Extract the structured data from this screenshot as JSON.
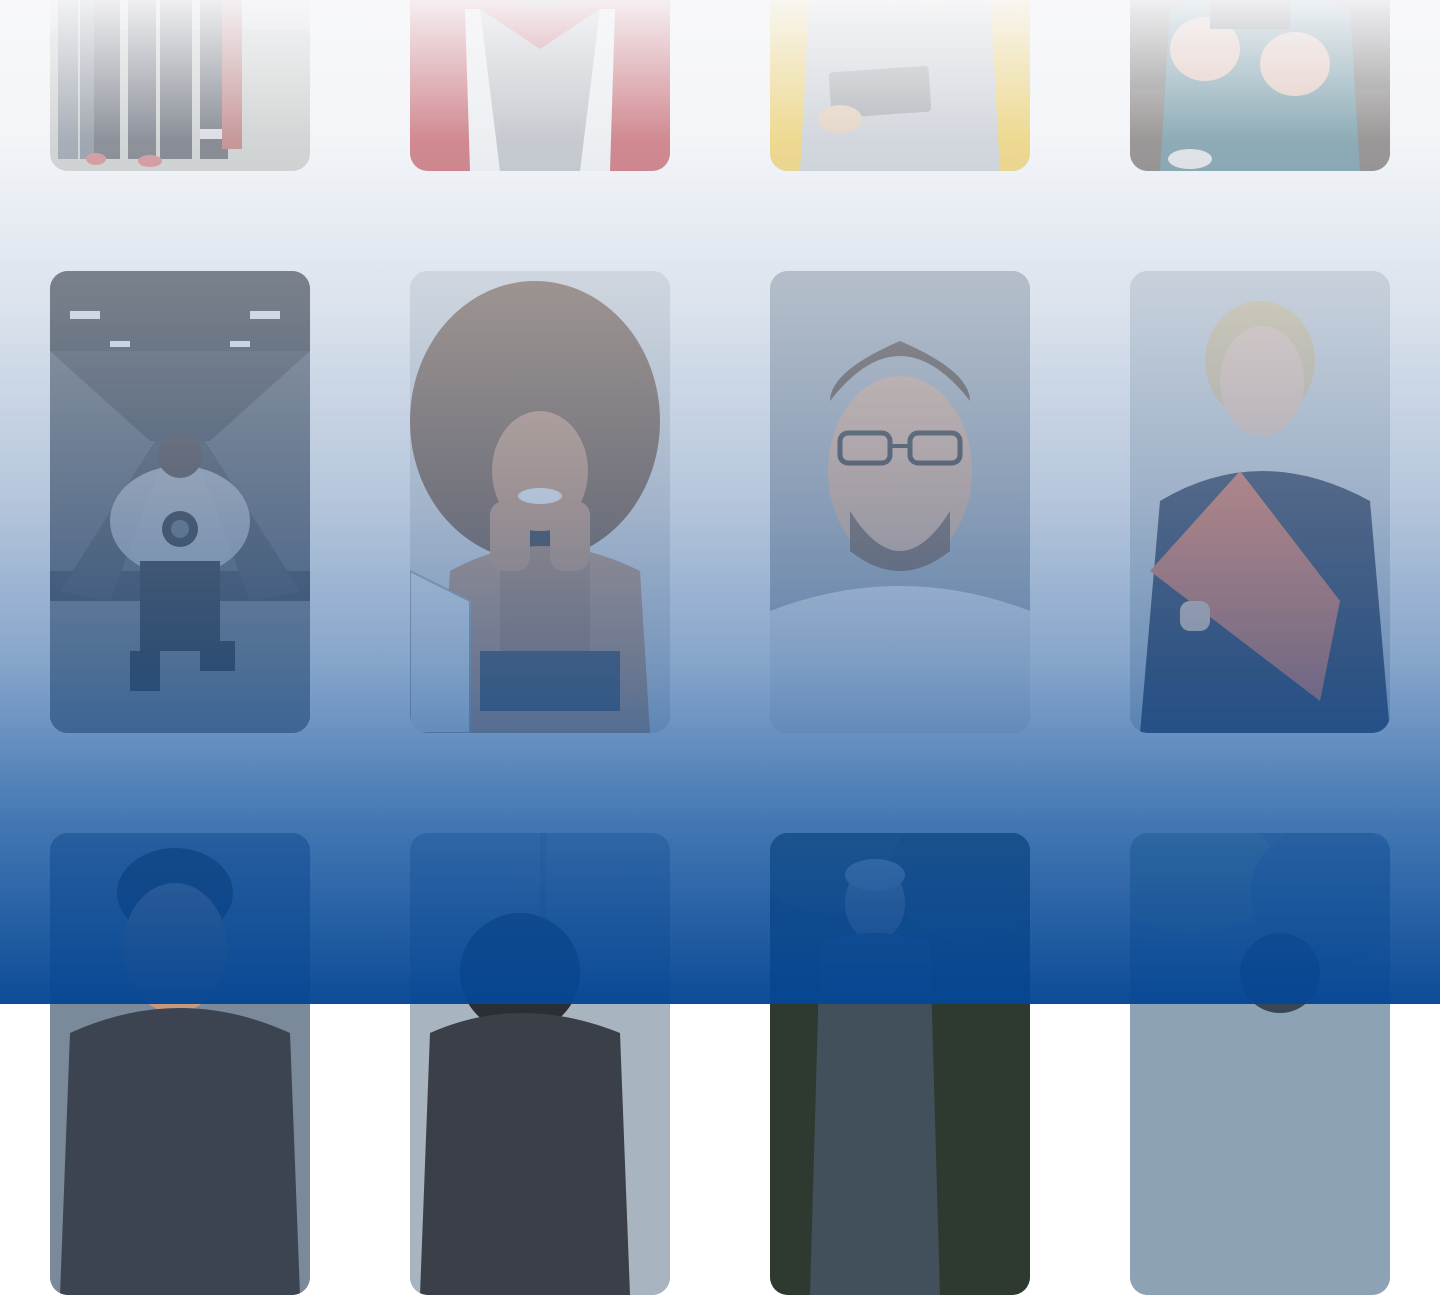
{
  "page": {
    "gradient_top": "#f6f6f8",
    "gradient_bottom": "#064a94"
  },
  "gallery": {
    "photos": [
      {
        "subject": "fitness-group-legs-photo"
      },
      {
        "subject": "man-red-jacket-photo"
      },
      {
        "subject": "woman-tablet-yellow-photo"
      },
      {
        "subject": "woman-ripped-jeans-photo"
      },
      {
        "subject": "photographer-escalator-photo"
      },
      {
        "subject": "curly-hair-woman-smiling-photo"
      },
      {
        "subject": "man-glasses-portrait-photo"
      },
      {
        "subject": "blonde-woman-folder-photo"
      },
      {
        "subject": "man-dark-hair-photo"
      },
      {
        "subject": "person-window-photo"
      },
      {
        "subject": "man-trees-outdoor-photo"
      },
      {
        "subject": "blurred-outdoor-photo"
      }
    ]
  }
}
